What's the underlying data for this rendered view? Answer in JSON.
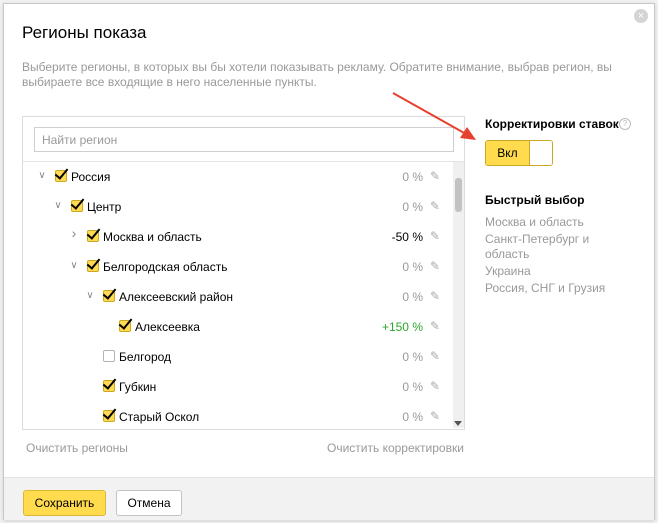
{
  "dialog": {
    "title": "Регионы показа",
    "close_glyph": "×",
    "description": "Выберите регионы, в которых вы бы хотели показывать рекламу. Обратите внимание, выбрав регион, вы выбираете все входящие в него населенные пункты."
  },
  "search": {
    "placeholder": "Найти регион",
    "value": ""
  },
  "tree": {
    "rows": [
      {
        "name": "Россия",
        "value": "0 %",
        "checked": true,
        "expanded": true,
        "level": 0
      },
      {
        "name": "Центр",
        "value": "0 %",
        "checked": true,
        "expanded": true,
        "level": 1
      },
      {
        "name": "Москва и область",
        "value": "-50 %",
        "checked": true,
        "expanded": false,
        "level": 2
      },
      {
        "name": "Белгородская область",
        "value": "0 %",
        "checked": true,
        "expanded": true,
        "level": 2
      },
      {
        "name": "Алексеевский район",
        "value": "0 %",
        "checked": true,
        "expanded": true,
        "level": 3
      },
      {
        "name": "Алексеевка",
        "value": "+150 %",
        "checked": true,
        "expanded": null,
        "level": 4
      },
      {
        "name": "Белгород",
        "value": "0 %",
        "checked": false,
        "expanded": null,
        "level": 3
      },
      {
        "name": "Губкин",
        "value": "0 %",
        "checked": true,
        "expanded": null,
        "level": 3
      },
      {
        "name": "Старый Оскол",
        "value": "0 %",
        "checked": true,
        "expanded": null,
        "level": 3
      }
    ]
  },
  "links": {
    "clear_regions": "Очистить регионы",
    "clear_bids": "Очистить корректировки"
  },
  "bids": {
    "title": "Корректировки ставок",
    "help_glyph": "?",
    "toggle_label": "Вкл"
  },
  "quick": {
    "title": "Быстрый выбор",
    "items": [
      "Москва и область",
      "Санкт-Петербург и область",
      "Украина",
      "Россия, СНГ и Грузия"
    ]
  },
  "footer": {
    "save_label": "Сохранить",
    "cancel_label": "Отмена"
  },
  "icons": {
    "expanded": "chevron-down-icon",
    "collapsed": "chevron-right-icon",
    "edit": "pencil-icon",
    "close": "close-icon",
    "help": "help-icon"
  },
  "colors": {
    "accent": "#ffdb4d",
    "positive": "#2aa52a",
    "muted": "#999999",
    "annotation": "#e8402f"
  }
}
